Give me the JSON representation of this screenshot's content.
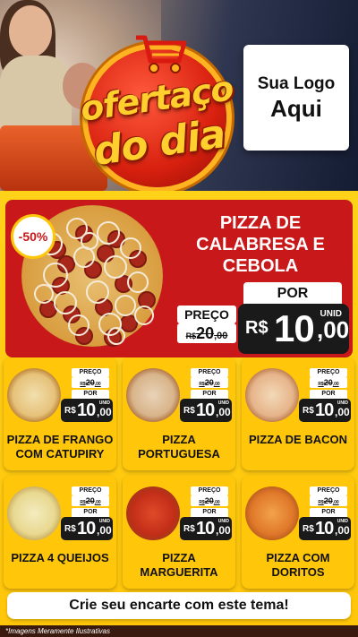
{
  "header": {
    "badge_line1": "ofertaço",
    "badge_line2": "do dia",
    "logo_line1": "Sua Logo",
    "logo_line2": "Aqui"
  },
  "featured": {
    "discount": "-50%",
    "title": "PIZZA DE CALABRESA E CEBOLA",
    "preco_label": "PREÇO",
    "por_label": "POR",
    "currency": "R$",
    "old_price_int": "20",
    "old_price_dec": ",00",
    "new_price_int": "10",
    "new_price_dec": ",00",
    "unit": "UNID"
  },
  "products": [
    {
      "name": "PIZZA DE FRANGO COM CATUPIRY",
      "preco_label": "PREÇO",
      "por_label": "POR",
      "currency": "R$",
      "old_int": "20",
      "old_dec": ",00",
      "new_int": "10",
      "new_dec": ",00",
      "unit": "UNID"
    },
    {
      "name": "PIZZA PORTUGUESA",
      "preco_label": "PREÇO",
      "por_label": "POR",
      "currency": "R$",
      "old_int": "20",
      "old_dec": ",00",
      "new_int": "10",
      "new_dec": ",00",
      "unit": "UNID"
    },
    {
      "name": "PIZZA DE BACON",
      "preco_label": "PREÇO",
      "por_label": "POR",
      "currency": "R$",
      "old_int": "20",
      "old_dec": ",00",
      "new_int": "10",
      "new_dec": ",00",
      "unit": "UNID"
    },
    {
      "name": "PIZZA 4 QUEIJOS",
      "preco_label": "PREÇO",
      "por_label": "POR",
      "currency": "R$",
      "old_int": "20",
      "old_dec": ",00",
      "new_int": "10",
      "new_dec": ",00",
      "unit": "UNID"
    },
    {
      "name": "PIZZA MARGUERITA",
      "preco_label": "PREÇO",
      "por_label": "POR",
      "currency": "R$",
      "old_int": "20",
      "old_dec": ",00",
      "new_int": "10",
      "new_dec": ",00",
      "unit": "UNID"
    },
    {
      "name": "PIZZA COM DORITOS",
      "preco_label": "PREÇO",
      "por_label": "POR",
      "currency": "R$",
      "old_int": "20",
      "old_dec": ",00",
      "new_int": "10",
      "new_dec": ",00",
      "unit": "UNID"
    }
  ],
  "cta": "Crie seu encarte com este tema!",
  "footer_note": "*Imagens Meramente Ilustrativas",
  "colors": {
    "primary_red": "#c8181a",
    "yellow": "#ffc60a",
    "price_black": "#1a1a1a"
  }
}
